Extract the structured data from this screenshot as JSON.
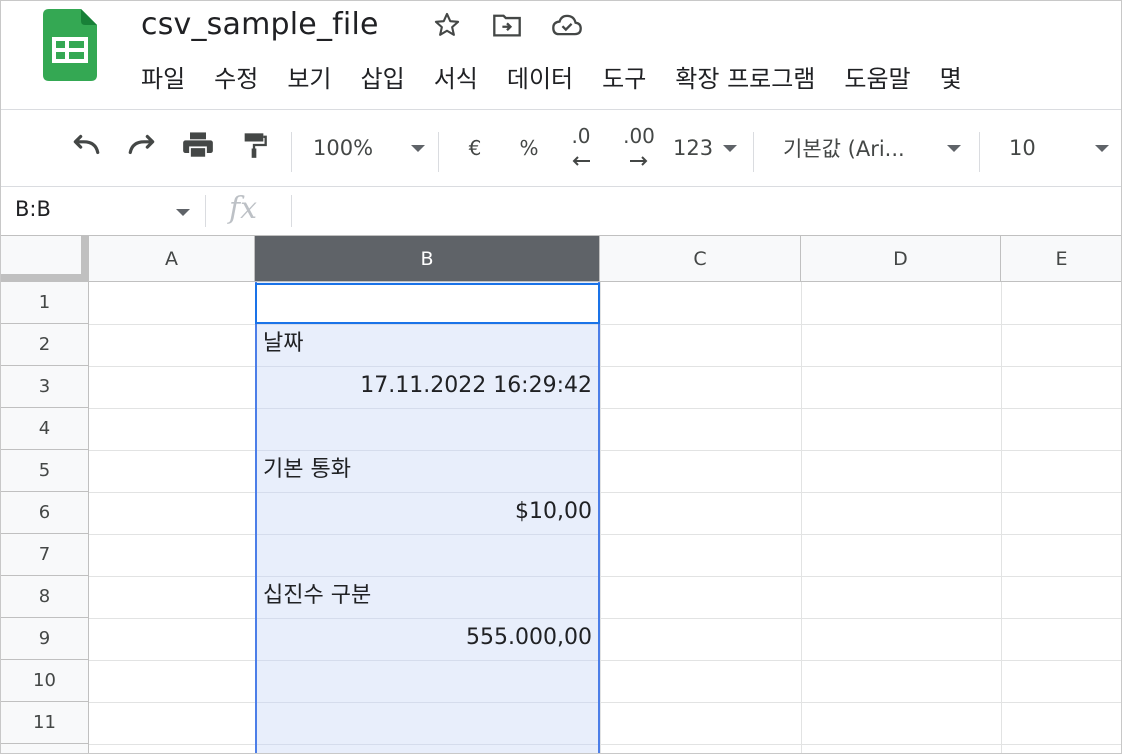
{
  "app": {
    "title": "csv_sample_file",
    "brand_color": "#34a853"
  },
  "title_icons": [
    "star-icon",
    "move-to-folder-icon",
    "cloud-saved-icon"
  ],
  "menu": {
    "items": [
      {
        "label": "파일"
      },
      {
        "label": "수정"
      },
      {
        "label": "보기"
      },
      {
        "label": "삽입"
      },
      {
        "label": "서식"
      },
      {
        "label": "데이터"
      },
      {
        "label": "도구"
      },
      {
        "label": "확장 프로그램"
      },
      {
        "label": "도움말"
      },
      {
        "label": "몇"
      }
    ]
  },
  "toolbar": {
    "zoom": "100%",
    "currency": "€",
    "percent": "%",
    "decimal_decrease": ".0",
    "decimal_increase": ".00",
    "number_format": "123",
    "font": "기본값 (Ari...",
    "font_size": "10"
  },
  "formula_bar": {
    "name_box": "B:B",
    "fx_label": "fx",
    "content": ""
  },
  "grid": {
    "columns": [
      "A",
      "B",
      "C",
      "D",
      "E"
    ],
    "selected_column": "B",
    "rows": [
      "1",
      "2",
      "3",
      "4",
      "5",
      "6",
      "7",
      "8",
      "9",
      "10",
      "11"
    ],
    "cells": {
      "B2": "날짜",
      "B3": "17.11.2022 16:29:42",
      "B5": "기본 통화",
      "B6": "$10,00",
      "B8": "십진수 구분",
      "B9": "555.000,00"
    }
  },
  "colors": {
    "selection_border": "#1a73e8",
    "selection_fill": "#e8eefb",
    "selected_header": "#5f6368"
  }
}
